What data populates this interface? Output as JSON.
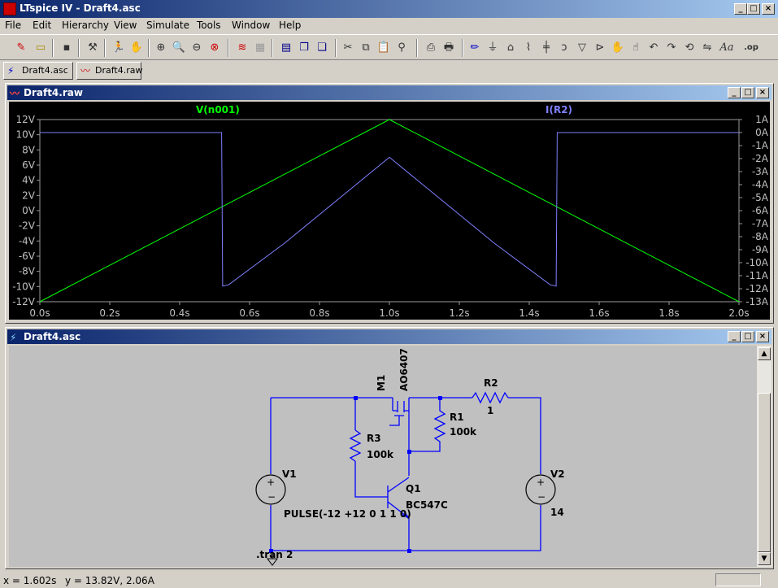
{
  "window": {
    "title": "LTspice IV - Draft4.asc",
    "min": "_",
    "max": "□",
    "close": "×"
  },
  "menu": [
    "File",
    "Edit",
    "Hierarchy",
    "View",
    "Simulate",
    "Tools",
    "Window",
    "Help"
  ],
  "toolbar_icons": [
    "new-schematic",
    "open",
    "save",
    "control-panel",
    "run",
    "halt",
    "zoom-in",
    "zoom-pan",
    "zoom-out",
    "zoom-cancel",
    "autorange",
    "grid",
    "tile-horizontal",
    "cascade",
    "tile-vertical",
    "cut",
    "copy",
    "paste",
    "find",
    "print-setup",
    "print",
    "wire",
    "ground",
    "label",
    "resistor",
    "capacitor",
    "inductor",
    "diode",
    "component",
    "move",
    "drag",
    "undo",
    "redo",
    "rotate",
    "mirror",
    "text",
    "spice-directive"
  ],
  "tabs": [
    {
      "label": "Draft4.asc"
    },
    {
      "label": "Draft4.raw"
    }
  ],
  "waveform_window": {
    "title": "Draft4.raw"
  },
  "schematic_window": {
    "title": "Draft4.asc"
  },
  "chart_data": {
    "type": "line",
    "x_ticks": [
      "0.0s",
      "0.2s",
      "0.4s",
      "0.6s",
      "0.8s",
      "1.0s",
      "1.2s",
      "1.4s",
      "1.6s",
      "1.8s",
      "2.0s"
    ],
    "y_left_ticks": [
      "12V",
      "10V",
      "8V",
      "6V",
      "4V",
      "2V",
      "0V",
      "-2V",
      "-4V",
      "-6V",
      "-8V",
      "-10V",
      "-12V"
    ],
    "y_right_ticks": [
      "1A",
      "0A",
      "-1A",
      "-2A",
      "-3A",
      "-4A",
      "-5A",
      "-6A",
      "-7A",
      "-8A",
      "-9A",
      "-10A",
      "-11A",
      "-12A",
      "-13A"
    ],
    "xlim": [
      0,
      2.0
    ],
    "ylim_left": [
      -12,
      12
    ],
    "ylim_right": [
      -13,
      1
    ],
    "series": [
      {
        "name": "V(n001)",
        "axis": "left",
        "color": "#00ff00",
        "x": [
          0,
          1.0,
          2.0
        ],
        "y": [
          -12,
          12,
          -12
        ]
      },
      {
        "name": "I(R2)",
        "axis": "right",
        "color": "#8080ff",
        "x": [
          0,
          0.52,
          0.523,
          0.54,
          0.7,
          1.0,
          1.3,
          1.46,
          1.477,
          1.48,
          2.0
        ],
        "y": [
          0,
          0,
          -11.8,
          -11.7,
          -8.5,
          -1.9,
          -8.5,
          -11.7,
          -11.8,
          0,
          0
        ]
      }
    ]
  },
  "schematic": {
    "m1_name": "M1",
    "m1_model": "AO6407",
    "r2_name": "R2",
    "r2_value": "1",
    "r1_name": "R1",
    "r1_value": "100k",
    "r3_name": "R3",
    "r3_value": "100k",
    "v1_name": "V1",
    "v1_value": "PULSE(-12 +12 0 1 1 0)",
    "v2_name": "V2",
    "v2_value": "14",
    "q1_name": "Q1",
    "q1_model": "BC547C",
    "directive": ".tran 2"
  },
  "status": {
    "x": "x = 1.602s",
    "y": "y = 13.82V, 2.06A"
  }
}
